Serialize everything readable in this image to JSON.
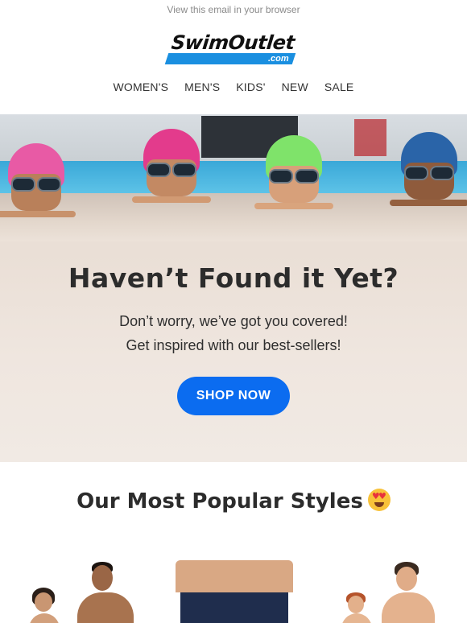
{
  "header": {
    "view_in_browser": "View this email in your browser",
    "logo_text": "SwimOutlet",
    "logo_suffix": ".com"
  },
  "nav": {
    "items": [
      "WOMEN'S",
      "MEN'S",
      "KIDS'",
      "NEW",
      "SALE"
    ]
  },
  "hero": {
    "title": "Haven’t Found it Yet?",
    "line1": "Don’t worry, we’ve got you covered!",
    "line2": "Get inspired with our best-sellers!",
    "cta": "SHOP NOW"
  },
  "section": {
    "title": "Our Most Popular Styles"
  },
  "colors": {
    "brand_blue": "#1a8fe0",
    "cta_blue": "#0b6cf0",
    "text_dark": "#2c2c2c"
  },
  "icons": {
    "section_emoji": "heart-eyes-emoji-icon"
  }
}
